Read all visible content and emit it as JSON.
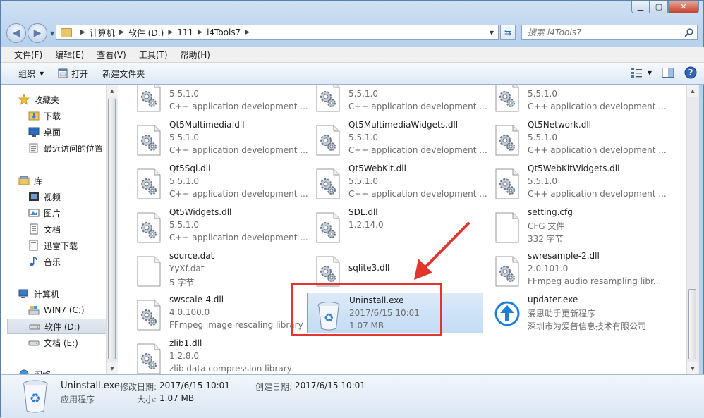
{
  "addressbar": {
    "crumbs": [
      "计算机",
      "软件 (D:)",
      "111",
      "i4Tools7"
    ],
    "search_placeholder": "搜索 i4Tools7"
  },
  "menu": [
    "文件(F)",
    "编辑(E)",
    "查看(V)",
    "工具(T)",
    "帮助(H)"
  ],
  "toolbar": {
    "organize": "组织",
    "open": "打开",
    "new_folder": "新建文件夹"
  },
  "navpane": {
    "items": [
      {
        "label": "收藏夹",
        "icon": "star-icon"
      },
      {
        "label": "下载",
        "icon": "download-folder-icon"
      },
      {
        "label": "桌面",
        "icon": "desktop-icon"
      },
      {
        "label": "最近访问的位置",
        "icon": "recent-places-icon"
      },
      {
        "label": "库",
        "icon": "library-icon"
      },
      {
        "label": "视频",
        "icon": "video-icon"
      },
      {
        "label": "图片",
        "icon": "pictures-icon"
      },
      {
        "label": "文档",
        "icon": "documents-icon"
      },
      {
        "label": "迅雷下载",
        "icon": "thunder-download-icon"
      },
      {
        "label": "音乐",
        "icon": "music-icon"
      },
      {
        "label": "计算机",
        "icon": "computer-icon"
      },
      {
        "label": "WIN7 (C:)",
        "icon": "system-drive-icon"
      },
      {
        "label": "软件 (D:)",
        "icon": "drive-icon"
      },
      {
        "label": "文档 (E:)",
        "icon": "drive-icon"
      },
      {
        "label": "网络",
        "icon": "network-icon"
      }
    ]
  },
  "files": [
    {
      "name": "",
      "l2": "5.5.1.0",
      "l3": "C++ application development ...",
      "icon": "dll-gear-icon"
    },
    {
      "name": "",
      "l2": "5.5.1.0",
      "l3": "C++ application development ...",
      "icon": "dll-gear-icon"
    },
    {
      "name": "",
      "l2": "5.5.1.0",
      "l3": "C++ application development ...",
      "icon": "dll-gear-icon"
    },
    {
      "name": "Qt5Multimedia.dll",
      "l2": "5.5.1.0",
      "l3": "C++ application development ...",
      "icon": "dll-gear-icon"
    },
    {
      "name": "Qt5MultimediaWidgets.dll",
      "l2": "5.5.1.0",
      "l3": "C++ application development ...",
      "icon": "dll-gear-icon"
    },
    {
      "name": "Qt5Network.dll",
      "l2": "5.5.1.0",
      "l3": "C++ application development ...",
      "icon": "dll-gear-icon"
    },
    {
      "name": "Qt5Sql.dll",
      "l2": "5.5.1.0",
      "l3": "C++ application development ...",
      "icon": "dll-gear-icon"
    },
    {
      "name": "Qt5WebKit.dll",
      "l2": "5.5.1.0",
      "l3": "C++ application development ...",
      "icon": "dll-gear-icon"
    },
    {
      "name": "Qt5WebKitWidgets.dll",
      "l2": "5.5.1.0",
      "l3": "C++ application development ...",
      "icon": "dll-gear-icon"
    },
    {
      "name": "Qt5Widgets.dll",
      "l2": "5.5.1.0",
      "l3": "C++ application development ...",
      "icon": "dll-gear-icon"
    },
    {
      "name": "SDL.dll",
      "l2": "1.2.14.0",
      "l3": "",
      "icon": "dll-gear-icon"
    },
    {
      "name": "setting.cfg",
      "l2": "CFG 文件",
      "l3": "332 字节",
      "icon": "blank-file-icon"
    },
    {
      "name": "source.dat",
      "l2": "YyXf.dat",
      "l3": "5 字节",
      "icon": "blank-file-icon"
    },
    {
      "name": "sqlite3.dll",
      "l2": "",
      "l3": "",
      "icon": "dll-gear-icon"
    },
    {
      "name": "swresample-2.dll",
      "l2": "2.0.101.0",
      "l3": "FFmpeg audio resampling libr...",
      "icon": "dll-gear-icon"
    },
    {
      "name": "swscale-4.dll",
      "l2": "4.0.100.0",
      "l3": "FFmpeg image rescaling library",
      "icon": "dll-gear-icon"
    },
    {
      "name": "Uninstall.exe",
      "l2": "2017/6/15 10:01",
      "l3": "1.07 MB",
      "icon": "recycle-bin-icon",
      "selected": true
    },
    {
      "name": "updater.exe",
      "l2": "爱思助手更新程序",
      "l3": "深圳市为爱普信息技术有限公司",
      "icon": "update-arrow-icon"
    },
    {
      "name": "zlib1.dll",
      "l2": "1.2.8.0",
      "l3": "zlib data compression library",
      "icon": "dll-gear-icon"
    }
  ],
  "details": {
    "name": "Uninstall.exe",
    "type": "应用程序",
    "modified_label": "修改日期:",
    "modified_value": "2017/6/15 10:01",
    "created_label": "创建日期:",
    "created_value": "2017/6/15 10:01",
    "size_label": "大小:",
    "size_value": "1.07 MB"
  },
  "colors": {
    "annotation": "#e0362d",
    "selection": "#c3dcf5",
    "accent": "#1e7fd6"
  }
}
